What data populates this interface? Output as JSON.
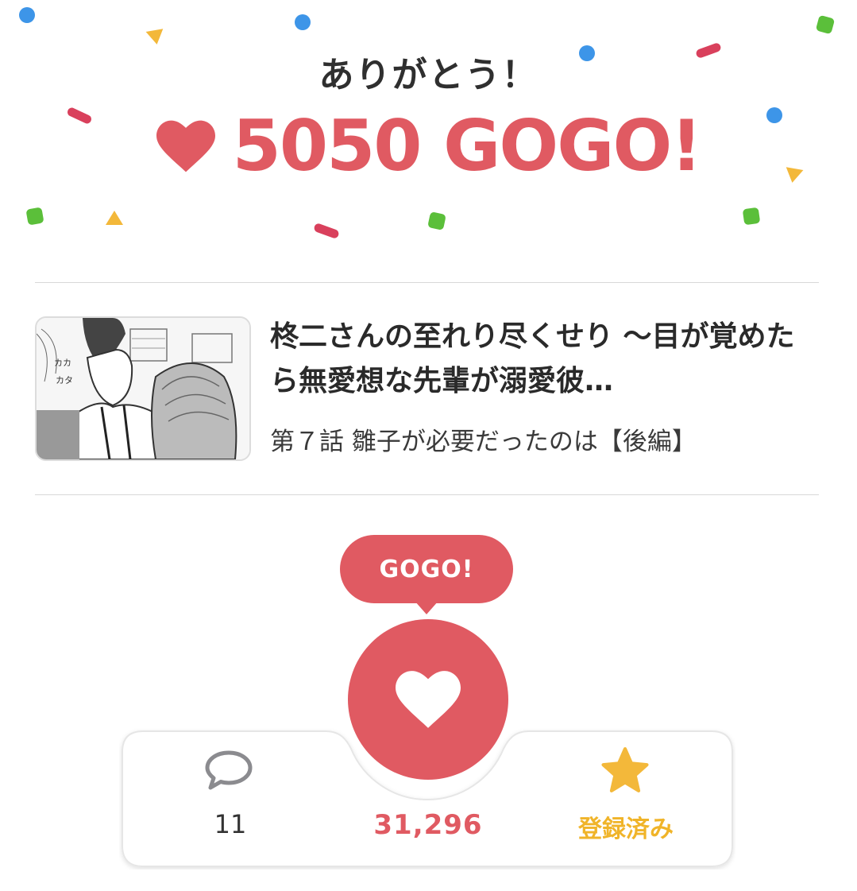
{
  "header": {
    "thanks": "ありがとう！",
    "count_text": "5050 GOGO!",
    "heart_icon": "heart-icon"
  },
  "episode": {
    "title": "柊二さんの至れり尽くせり ～目が覚めたら無愛想な先輩が溺愛彼…",
    "subtitle": "第７話 雛子が必要だったのは【後編】",
    "thumbnail": "manga-panel-thumbnail"
  },
  "gogo": {
    "bubble_label": "GOGO!",
    "button_icon": "heart-icon"
  },
  "actions": {
    "comment_icon": "speech-bubble-icon",
    "comment_count": "11",
    "like_count": "31,296",
    "bookmark_icon": "star-icon",
    "bookmark_label": "登録済み"
  },
  "colors": {
    "accent": "#e05a62",
    "star": "#f3b83a",
    "bookmark_text": "#f0b429",
    "confetti_blue": "#3d95e8",
    "confetti_green": "#5bbf3a",
    "confetti_yellow": "#f3b83a",
    "confetti_pink": "#d9405c"
  }
}
